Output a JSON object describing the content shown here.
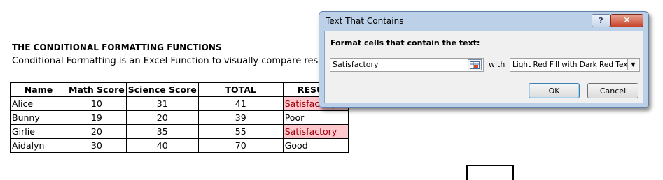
{
  "sheet": {
    "title": "THE CONDITIONAL FORMATTING FUNCTIONS",
    "description": "Conditional Formatting is an Excel Function to visually compare results b"
  },
  "table": {
    "headers": [
      "Name",
      "Math Score",
      "Science Score",
      "TOTAL",
      "RESULT"
    ],
    "rows": [
      {
        "name": "Alice",
        "math": "10",
        "science": "31",
        "total": "41",
        "result": "Satisfactory",
        "highlighted": true
      },
      {
        "name": "Bunny",
        "math": "19",
        "science": "20",
        "total": "39",
        "result": "Poor",
        "highlighted": false
      },
      {
        "name": "Girlie",
        "math": "20",
        "science": "35",
        "total": "55",
        "result": "Satisfactory",
        "highlighted": true
      },
      {
        "name": "Aidalyn",
        "math": "30",
        "science": "40",
        "total": "70",
        "result": "Good",
        "highlighted": false
      }
    ],
    "highlight_fill": "#ffc7ce",
    "highlight_text": "#9c0006"
  },
  "dialog": {
    "title": "Text That Contains",
    "help_label": "?",
    "close_label": "✕",
    "prompt": "Format cells that contain the text:",
    "input_value": "Satisfactory",
    "with_label": "with",
    "format_value": "Light Red Fill with Dark Red Text",
    "ok_label": "OK",
    "cancel_label": "Cancel"
  }
}
